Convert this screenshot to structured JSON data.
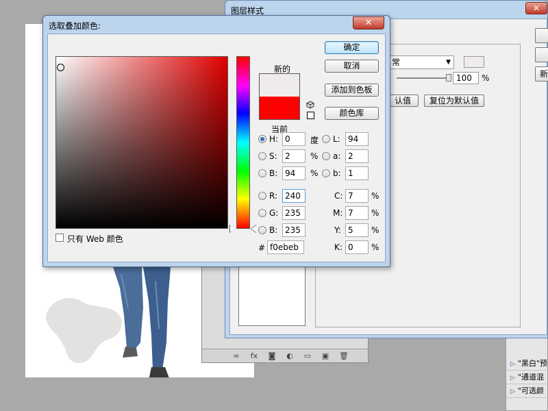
{
  "canvas": {
    "background": "#ffffff"
  },
  "layer_style_dialog": {
    "title": "图层样式",
    "close_label": "✕",
    "blend_mode_value": "常",
    "opacity_value": "100",
    "opacity_unit": "%",
    "set_default_button": "认值",
    "reset_default_button": "复位为默认值",
    "right_button_partial": "新"
  },
  "color_picker": {
    "title": "选取叠加颜色:",
    "close_label": "✕",
    "new_label": "新的",
    "current_label": "当前",
    "new_color": "#f0ebeb",
    "current_color": "#ff0000",
    "buttons": {
      "ok": "确定",
      "cancel": "取消",
      "add_to_swatches": "添加到色板",
      "color_libraries": "颜色库"
    },
    "hsb": {
      "h_label": "H:",
      "h_value": "0",
      "h_unit": "度",
      "s_label": "S:",
      "s_value": "2",
      "s_unit": "%",
      "b_label": "B:",
      "b_value": "94",
      "b_unit": "%"
    },
    "rgb": {
      "r_label": "R:",
      "r_value": "240",
      "g_label": "G:",
      "g_value": "235",
      "b_label": "B:",
      "b_value": "235"
    },
    "lab": {
      "l_label": "L:",
      "l_value": "94",
      "a_label": "a:",
      "a_value": "2",
      "b_label": "b:",
      "b_value": "1"
    },
    "cmyk": {
      "c_label": "C:",
      "c_value": "7",
      "c_unit": "%",
      "m_label": "M:",
      "m_value": "7",
      "m_unit": "%",
      "y_label": "Y:",
      "y_value": "5",
      "y_unit": "%",
      "k_label": "K:",
      "k_value": "0",
      "k_unit": "%"
    },
    "hex_label": "#",
    "hex_value": "f0ebeb",
    "web_only_label": "只有 Web 颜色"
  },
  "layers_panel": {
    "footer_icons": [
      "link-icon",
      "fx-icon",
      "mask-icon",
      "adjustment-icon",
      "folder-icon",
      "new-layer-icon",
      "trash-icon"
    ],
    "fx_label": "fx"
  },
  "actions_panel": {
    "items": [
      {
        "label": "\"黑白\"预"
      },
      {
        "label": "\"通道混"
      },
      {
        "label": "\"可选颜"
      }
    ]
  }
}
